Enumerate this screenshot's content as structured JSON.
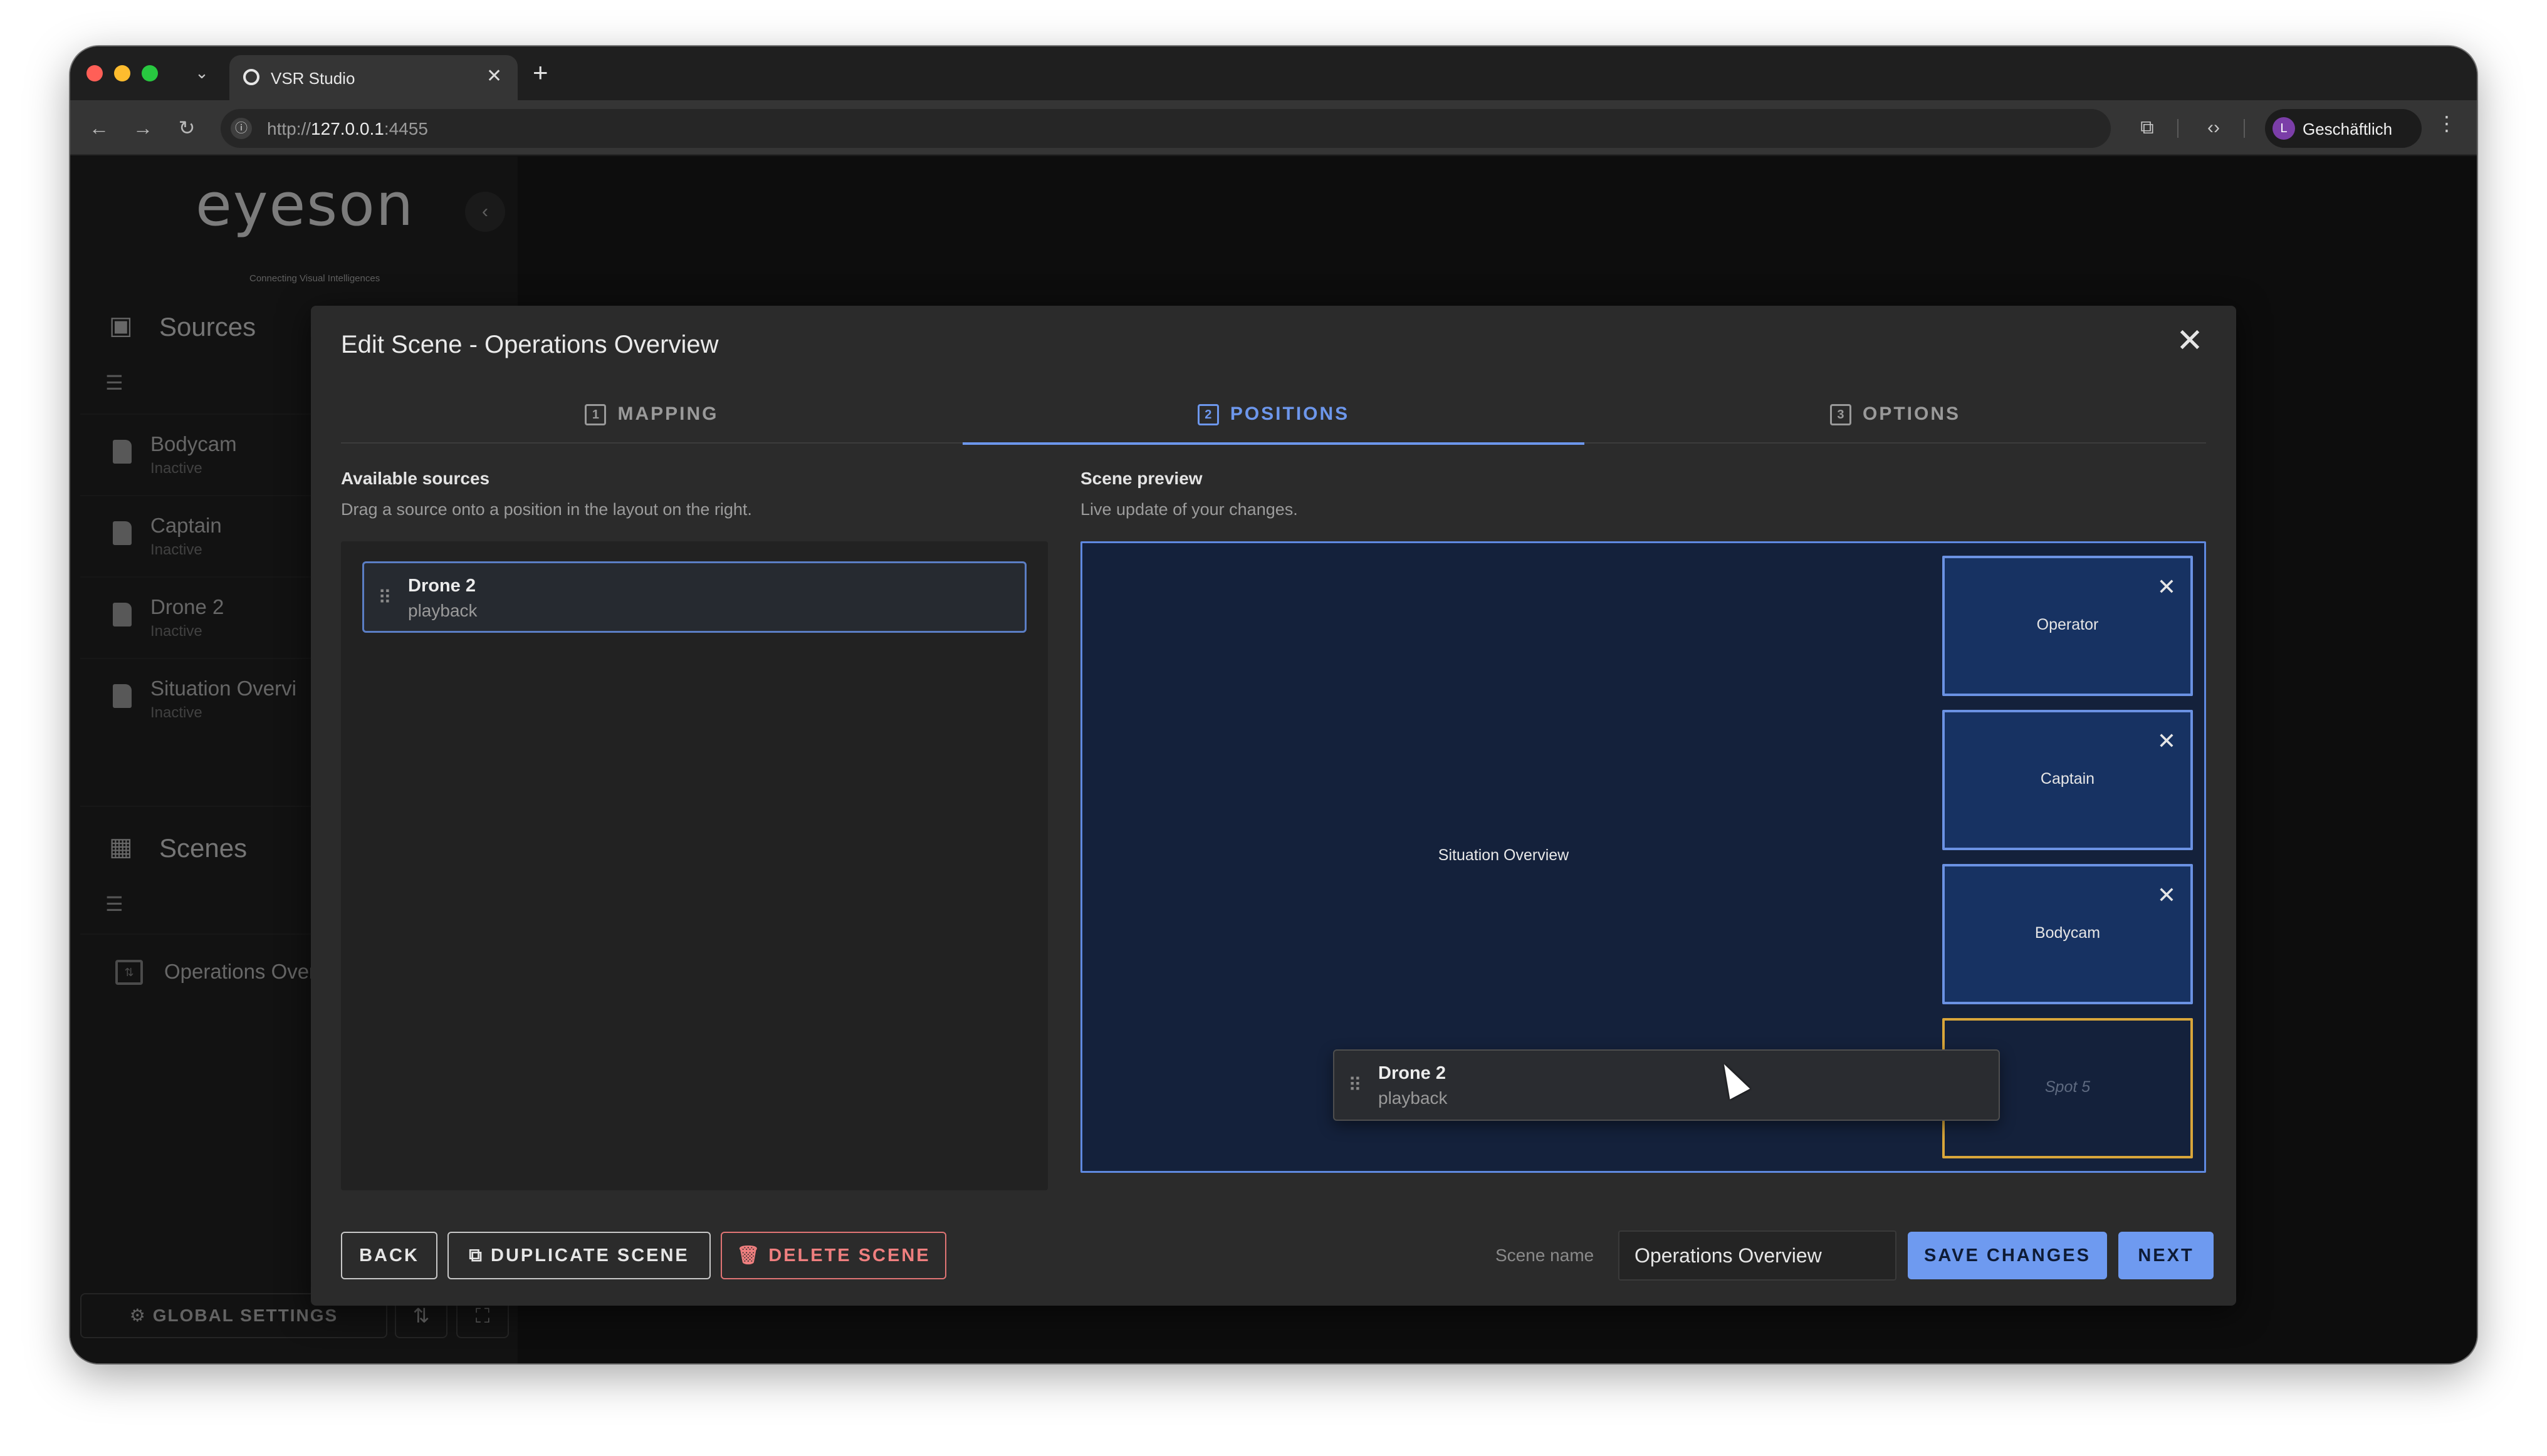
{
  "browser": {
    "tab_title": "VSR Studio",
    "tab_close": "✕",
    "new_tab": "+",
    "url_prefix": "http://",
    "url_host": "127.0.0.1",
    "url_port": ":4455",
    "profile_initial": "L",
    "profile_label": "Geschäftlich",
    "traffic_lights": [
      "#ff5f57",
      "#febc2e",
      "#28c840"
    ]
  },
  "sidebar": {
    "logo": "eyeson",
    "logo_tagline": "Connecting Visual Intelligences",
    "sources_title": "Sources",
    "sources": [
      {
        "name": "Bodycam",
        "status": "Inactive"
      },
      {
        "name": "Captain",
        "status": "Inactive"
      },
      {
        "name": "Drone 2",
        "status": "Inactive"
      },
      {
        "name": "Situation Overvi",
        "status": "Inactive"
      }
    ],
    "scenes_title": "Scenes",
    "scenes": [
      {
        "name": "Operations Over"
      }
    ],
    "global_settings": "GLOBAL SETTINGS"
  },
  "modal": {
    "title": "Edit Scene - Operations Overview",
    "tabs": [
      {
        "num": "1",
        "label": "MAPPING"
      },
      {
        "num": "2",
        "label": "POSITIONS"
      },
      {
        "num": "3",
        "label": "OPTIONS"
      }
    ],
    "available": {
      "title": "Available sources",
      "subtitle": "Drag a source onto a position in the layout on the right.",
      "items": [
        {
          "name": "Drone 2",
          "type": "playback"
        }
      ]
    },
    "preview": {
      "title": "Scene preview",
      "subtitle": "Live update of your changes.",
      "main_slot": "Situation Overview",
      "spots": [
        "Operator",
        "Captain",
        "Bodycam",
        "Spot 5"
      ],
      "dragging": {
        "name": "Drone 2",
        "type": "playback"
      }
    },
    "footer": {
      "back": "BACK",
      "duplicate": "DUPLICATE SCENE",
      "delete": "DELETE SCENE",
      "scene_name_label": "Scene name",
      "scene_name_value": "Operations Overview",
      "save": "SAVE CHANGES",
      "next": "NEXT"
    }
  }
}
